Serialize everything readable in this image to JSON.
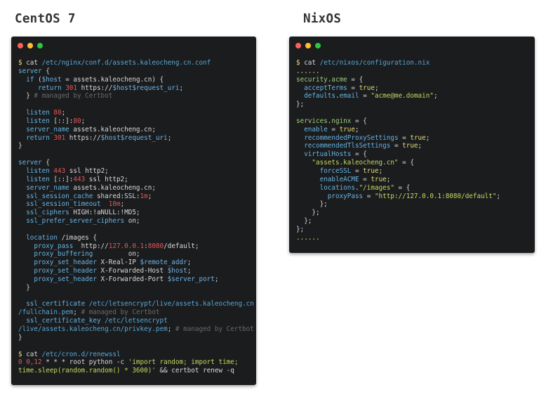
{
  "headings": {
    "left": "CentOS 7",
    "right": "NixOS"
  },
  "colors": {
    "window_dot_close": "#ff5f56",
    "window_dot_min": "#ffbd2e",
    "window_dot_max": "#27c93f",
    "terminal_bg": "#1b1c1e"
  },
  "terminals": {
    "centos": {
      "lines": [
        [
          [
            "prompt",
            "$ "
          ],
          [
            "plain",
            "cat "
          ],
          [
            "path",
            "/etc/nginx/conf.d/assets.kaleocheng.cn.conf"
          ]
        ],
        [
          [
            "kw",
            "server"
          ],
          [
            "plain",
            " {"
          ]
        ],
        [
          [
            "plain",
            "  "
          ],
          [
            "kw",
            "if"
          ],
          [
            "plain",
            " ("
          ],
          [
            "var",
            "$host"
          ],
          [
            "plain",
            " = assets.kaleocheng.cn) {"
          ]
        ],
        [
          [
            "plain",
            "     "
          ],
          [
            "kw",
            "return"
          ],
          [
            "plain",
            " "
          ],
          [
            "num",
            "301"
          ],
          [
            "plain",
            " https://"
          ],
          [
            "var",
            "$host$request_uri"
          ],
          [
            "plain",
            ";"
          ]
        ],
        [
          [
            "plain",
            "  } "
          ],
          [
            "com",
            "# managed by Certbot"
          ]
        ],
        [
          [
            "plain",
            ""
          ]
        ],
        [
          [
            "plain",
            "  "
          ],
          [
            "kw",
            "listen"
          ],
          [
            "plain",
            " "
          ],
          [
            "num",
            "80"
          ],
          [
            "plain",
            ";"
          ]
        ],
        [
          [
            "plain",
            "  "
          ],
          [
            "kw",
            "listen"
          ],
          [
            "plain",
            " [::]:"
          ],
          [
            "num",
            "80"
          ],
          [
            "plain",
            ";"
          ]
        ],
        [
          [
            "plain",
            "  "
          ],
          [
            "kw",
            "server_name"
          ],
          [
            "plain",
            " assets.kaleocheng.cn;"
          ]
        ],
        [
          [
            "plain",
            "  "
          ],
          [
            "kw",
            "return"
          ],
          [
            "plain",
            " "
          ],
          [
            "num",
            "301"
          ],
          [
            "plain",
            " https://"
          ],
          [
            "var",
            "$host$request_uri"
          ],
          [
            "plain",
            ";"
          ]
        ],
        [
          [
            "plain",
            "}"
          ]
        ],
        [
          [
            "plain",
            ""
          ]
        ],
        [
          [
            "kw",
            "server"
          ],
          [
            "plain",
            " {"
          ]
        ],
        [
          [
            "plain",
            "  "
          ],
          [
            "kw",
            "listen"
          ],
          [
            "plain",
            " "
          ],
          [
            "num",
            "443"
          ],
          [
            "plain",
            " ssl http2;"
          ]
        ],
        [
          [
            "plain",
            "  "
          ],
          [
            "kw",
            "listen"
          ],
          [
            "plain",
            " [::]:"
          ],
          [
            "num",
            "443"
          ],
          [
            "plain",
            " ssl http2;"
          ]
        ],
        [
          [
            "plain",
            "  "
          ],
          [
            "kw",
            "server_name"
          ],
          [
            "plain",
            " assets.kaleocheng.cn;"
          ]
        ],
        [
          [
            "plain",
            "  "
          ],
          [
            "kw",
            "ssl_session_cache"
          ],
          [
            "plain",
            " shared:SSL:"
          ],
          [
            "num",
            "1m"
          ],
          [
            "plain",
            ";"
          ]
        ],
        [
          [
            "plain",
            "  "
          ],
          [
            "kw",
            "ssl_session_timeout"
          ],
          [
            "plain",
            "  "
          ],
          [
            "num",
            "10m"
          ],
          [
            "plain",
            ";"
          ]
        ],
        [
          [
            "plain",
            "  "
          ],
          [
            "kw",
            "ssl_ciphers"
          ],
          [
            "plain",
            " HIGH:!aNULL:!MD5;"
          ]
        ],
        [
          [
            "plain",
            "  "
          ],
          [
            "kw",
            "ssl_prefer_server_ciphers"
          ],
          [
            "plain",
            " on;"
          ]
        ],
        [
          [
            "plain",
            ""
          ]
        ],
        [
          [
            "plain",
            "  "
          ],
          [
            "kw",
            "location"
          ],
          [
            "plain",
            " /images {"
          ]
        ],
        [
          [
            "plain",
            "    "
          ],
          [
            "kw",
            "proxy_pass"
          ],
          [
            "plain",
            "  http://"
          ],
          [
            "num",
            "127.0.0.1"
          ],
          [
            "plain",
            ":"
          ],
          [
            "num",
            "8080"
          ],
          [
            "plain",
            "/default;"
          ]
        ],
        [
          [
            "plain",
            "    "
          ],
          [
            "kw",
            "proxy_buffering"
          ],
          [
            "plain",
            "         on;"
          ]
        ],
        [
          [
            "plain",
            "    "
          ],
          [
            "kw",
            "proxy_set_header"
          ],
          [
            "plain",
            " X-Real-IP "
          ],
          [
            "var",
            "$remote_addr"
          ],
          [
            "plain",
            ";"
          ]
        ],
        [
          [
            "plain",
            "    "
          ],
          [
            "kw",
            "proxy_set_header"
          ],
          [
            "plain",
            " X-Forwarded-Host "
          ],
          [
            "var",
            "$host"
          ],
          [
            "plain",
            ";"
          ]
        ],
        [
          [
            "plain",
            "    "
          ],
          [
            "kw",
            "proxy_set_header"
          ],
          [
            "plain",
            " X-Forwarded-Port "
          ],
          [
            "var",
            "$server_port"
          ],
          [
            "plain",
            ";"
          ]
        ],
        [
          [
            "plain",
            "  }"
          ]
        ],
        [
          [
            "plain",
            ""
          ]
        ],
        [
          [
            "plain",
            "  "
          ],
          [
            "kw",
            "ssl_certificate"
          ],
          [
            "plain",
            " "
          ],
          [
            "path",
            "/etc/letsencrypt/live/assets.kaleocheng.cn"
          ]
        ],
        [
          [
            "path",
            "/fullchain.pem"
          ],
          [
            "plain",
            "; "
          ],
          [
            "com",
            "# managed by Certbot"
          ]
        ],
        [
          [
            "plain",
            "  "
          ],
          [
            "kw",
            "ssl_certificate_key"
          ],
          [
            "plain",
            " "
          ],
          [
            "path",
            "/etc/letsencrypt"
          ]
        ],
        [
          [
            "path",
            "/live/assets.kaleocheng.cn/privkey.pem"
          ],
          [
            "plain",
            "; "
          ],
          [
            "com",
            "# managed by Certbot"
          ]
        ],
        [
          [
            "plain",
            "}"
          ]
        ],
        [
          [
            "plain",
            ""
          ]
        ],
        [
          [
            "prompt",
            "$ "
          ],
          [
            "plain",
            "cat "
          ],
          [
            "path",
            "/etc/cron.d/renewssl"
          ]
        ],
        [
          [
            "num",
            "0 0,12"
          ],
          [
            "plain",
            " * * * root python -c "
          ],
          [
            "str",
            "'import random; import time;"
          ]
        ],
        [
          [
            "str",
            "time.sleep(random.random() * 3600)'"
          ],
          [
            "plain",
            " && certbot renew -q"
          ]
        ]
      ]
    },
    "nixos": {
      "lines": [
        [
          [
            "prompt",
            "$ "
          ],
          [
            "plain",
            "cat "
          ],
          [
            "path",
            "/etc/nixos/configuration.nix"
          ]
        ],
        [
          [
            "prompt",
            "......"
          ]
        ],
        [
          [
            "attr",
            "security"
          ],
          [
            "plain",
            "."
          ],
          [
            "attr",
            "acme"
          ],
          [
            "plain",
            " = {"
          ]
        ],
        [
          [
            "plain",
            "  "
          ],
          [
            "kw",
            "acceptTerms"
          ],
          [
            "plain",
            " = "
          ],
          [
            "bool",
            "true"
          ],
          [
            "plain",
            ";"
          ]
        ],
        [
          [
            "plain",
            "  "
          ],
          [
            "kw",
            "defaults"
          ],
          [
            "plain",
            "."
          ],
          [
            "kw",
            "email"
          ],
          [
            "plain",
            " = "
          ],
          [
            "str",
            "\"acme@me.domain\""
          ],
          [
            "plain",
            ";"
          ]
        ],
        [
          [
            "plain",
            "};"
          ]
        ],
        [
          [
            "plain",
            ""
          ]
        ],
        [
          [
            "attr",
            "services"
          ],
          [
            "plain",
            "."
          ],
          [
            "attr",
            "nginx"
          ],
          [
            "plain",
            " = {"
          ]
        ],
        [
          [
            "plain",
            "  "
          ],
          [
            "kw",
            "enable"
          ],
          [
            "plain",
            " = "
          ],
          [
            "bool",
            "true"
          ],
          [
            "plain",
            ";"
          ]
        ],
        [
          [
            "plain",
            "  "
          ],
          [
            "kw",
            "recommendedProxySettings"
          ],
          [
            "plain",
            " = "
          ],
          [
            "bool",
            "true"
          ],
          [
            "plain",
            ";"
          ]
        ],
        [
          [
            "plain",
            "  "
          ],
          [
            "kw",
            "recommendedTlsSettings"
          ],
          [
            "plain",
            " = "
          ],
          [
            "bool",
            "true"
          ],
          [
            "plain",
            ";"
          ]
        ],
        [
          [
            "plain",
            "  "
          ],
          [
            "kw",
            "virtualHosts"
          ],
          [
            "plain",
            " = {"
          ]
        ],
        [
          [
            "plain",
            "    "
          ],
          [
            "str",
            "\"assets.kaleocheng.cn\""
          ],
          [
            "plain",
            " = {"
          ]
        ],
        [
          [
            "plain",
            "      "
          ],
          [
            "kw",
            "forceSSL"
          ],
          [
            "plain",
            " = "
          ],
          [
            "bool",
            "true"
          ],
          [
            "plain",
            ";"
          ]
        ],
        [
          [
            "plain",
            "      "
          ],
          [
            "kw",
            "enableACME"
          ],
          [
            "plain",
            " = "
          ],
          [
            "bool",
            "true"
          ],
          [
            "plain",
            ";"
          ]
        ],
        [
          [
            "plain",
            "      "
          ],
          [
            "kw",
            "locations"
          ],
          [
            "plain",
            "."
          ],
          [
            "str",
            "\"/images\""
          ],
          [
            "plain",
            " = {"
          ]
        ],
        [
          [
            "plain",
            "        "
          ],
          [
            "kw",
            "proxyPass"
          ],
          [
            "plain",
            " = "
          ],
          [
            "str",
            "\"http://127.0.0.1:8080/default\""
          ],
          [
            "plain",
            ";"
          ]
        ],
        [
          [
            "plain",
            "      };"
          ]
        ],
        [
          [
            "plain",
            "    };"
          ]
        ],
        [
          [
            "plain",
            "  };"
          ]
        ],
        [
          [
            "plain",
            "};"
          ]
        ],
        [
          [
            "prompt",
            "......"
          ]
        ]
      ]
    }
  }
}
